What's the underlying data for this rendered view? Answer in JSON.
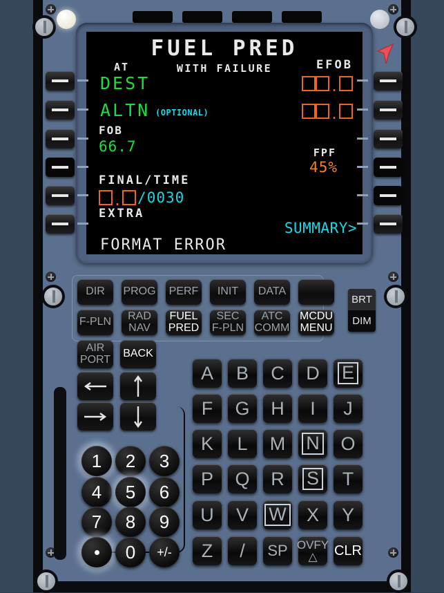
{
  "device": {
    "name": "MCDU",
    "colors": {
      "screen_bg": "#000000",
      "green": "#18e03a",
      "cyan": "#15d8e8",
      "amber": "#f0851e",
      "amber_box": "#f2631b",
      "white": "#e9e9e9",
      "panel": "#5b708e"
    }
  },
  "screen": {
    "title": "FUEL PRED",
    "subtitle": "WITH FAILURE",
    "label_at": "AT",
    "label_efob": "EFOB",
    "dest_label": "DEST",
    "altn_label": "ALTN",
    "altn_optional": "(OPTIONAL)",
    "efob_dest_value": "",
    "efob_altn_value": "",
    "fob_label": "FOB",
    "fob_value": "66.7",
    "fpf_label": "FPF",
    "fpf_value": "45%",
    "final_label": "FINAL/TIME",
    "final_time_value": "/0030",
    "extra_label": "EXTRA",
    "summary_label": "SUMMARY>",
    "scratchpad": "FORMAT ERROR"
  },
  "function_keys": {
    "row1": [
      {
        "label": "DIR",
        "lit": false
      },
      {
        "label": "PROG",
        "lit": false
      },
      {
        "label": "PERF",
        "lit": false
      },
      {
        "label": "INIT",
        "lit": false
      },
      {
        "label": "DATA",
        "lit": false
      },
      {
        "label": "",
        "lit": false
      }
    ],
    "row2": [
      {
        "line1": "F-PLN",
        "line2": "",
        "lit": false
      },
      {
        "line1": "RAD",
        "line2": "NAV",
        "lit": false
      },
      {
        "line1": "FUEL",
        "line2": "PRED",
        "lit": true
      },
      {
        "line1": "SEC",
        "line2": "F-PLN",
        "lit": false
      },
      {
        "line1": "ATC",
        "line2": "COMM",
        "lit": false
      },
      {
        "line1": "MCDU",
        "line2": "MENU",
        "lit": true
      }
    ]
  },
  "brightness": {
    "brt_label": "BRT",
    "dim_label": "DIM"
  },
  "nav_keys": [
    {
      "line1": "AIR",
      "line2": "PORT",
      "lit": false,
      "icon": ""
    },
    {
      "line1": "BACK",
      "line2": "",
      "lit": true,
      "icon": ""
    },
    {
      "line1": "",
      "line2": "",
      "lit": false,
      "icon": "arrow-left-icon"
    },
    {
      "line1": "",
      "line2": "",
      "lit": false,
      "icon": "arrow-up-icon"
    },
    {
      "line1": "",
      "line2": "",
      "lit": false,
      "icon": "arrow-right-icon"
    },
    {
      "line1": "",
      "line2": "",
      "lit": false,
      "icon": "arrow-down-icon"
    }
  ],
  "numeric_keys": [
    {
      "label": "1",
      "glow": true
    },
    {
      "label": "2",
      "glow": false
    },
    {
      "label": "3",
      "glow": false
    },
    {
      "label": "4",
      "glow": false
    },
    {
      "label": "5",
      "glow": true
    },
    {
      "label": "6",
      "glow": false
    },
    {
      "label": "7",
      "glow": false
    },
    {
      "label": "8",
      "glow": false
    },
    {
      "label": "9",
      "glow": false
    },
    {
      "label": ".",
      "glow": true
    },
    {
      "label": "0",
      "glow": false
    },
    {
      "label": "+/-",
      "glow": false
    }
  ],
  "alpha_keys": [
    {
      "label": "A",
      "boxed": false
    },
    {
      "label": "B",
      "boxed": false
    },
    {
      "label": "C",
      "boxed": false
    },
    {
      "label": "D",
      "boxed": false
    },
    {
      "label": "E",
      "boxed": true
    },
    {
      "label": "F",
      "boxed": false
    },
    {
      "label": "G",
      "boxed": false
    },
    {
      "label": "H",
      "boxed": false
    },
    {
      "label": "I",
      "boxed": false
    },
    {
      "label": "J",
      "boxed": false
    },
    {
      "label": "K",
      "boxed": false
    },
    {
      "label": "L",
      "boxed": false
    },
    {
      "label": "M",
      "boxed": false
    },
    {
      "label": "N",
      "boxed": true
    },
    {
      "label": "O",
      "boxed": false
    },
    {
      "label": "P",
      "boxed": false
    },
    {
      "label": "Q",
      "boxed": false
    },
    {
      "label": "R",
      "boxed": false
    },
    {
      "label": "S",
      "boxed": true
    },
    {
      "label": "T",
      "boxed": false
    },
    {
      "label": "U",
      "boxed": false
    },
    {
      "label": "V",
      "boxed": false
    },
    {
      "label": "W",
      "boxed": true
    },
    {
      "label": "X",
      "boxed": false
    },
    {
      "label": "Y",
      "boxed": false
    },
    {
      "label": "Z",
      "boxed": false
    },
    {
      "label": "/",
      "boxed": false
    },
    {
      "label": "SP",
      "boxed": false
    },
    {
      "label": "OVFY",
      "boxed": false,
      "sub": "△"
    },
    {
      "label": "CLR",
      "boxed": false,
      "lit": true
    }
  ],
  "line_select_keys": {
    "left": [
      "L1",
      "L2",
      "L3",
      "L4",
      "L5",
      "L6"
    ],
    "right": [
      "R1",
      "R2",
      "R3",
      "R4",
      "R5",
      "R6"
    ]
  }
}
